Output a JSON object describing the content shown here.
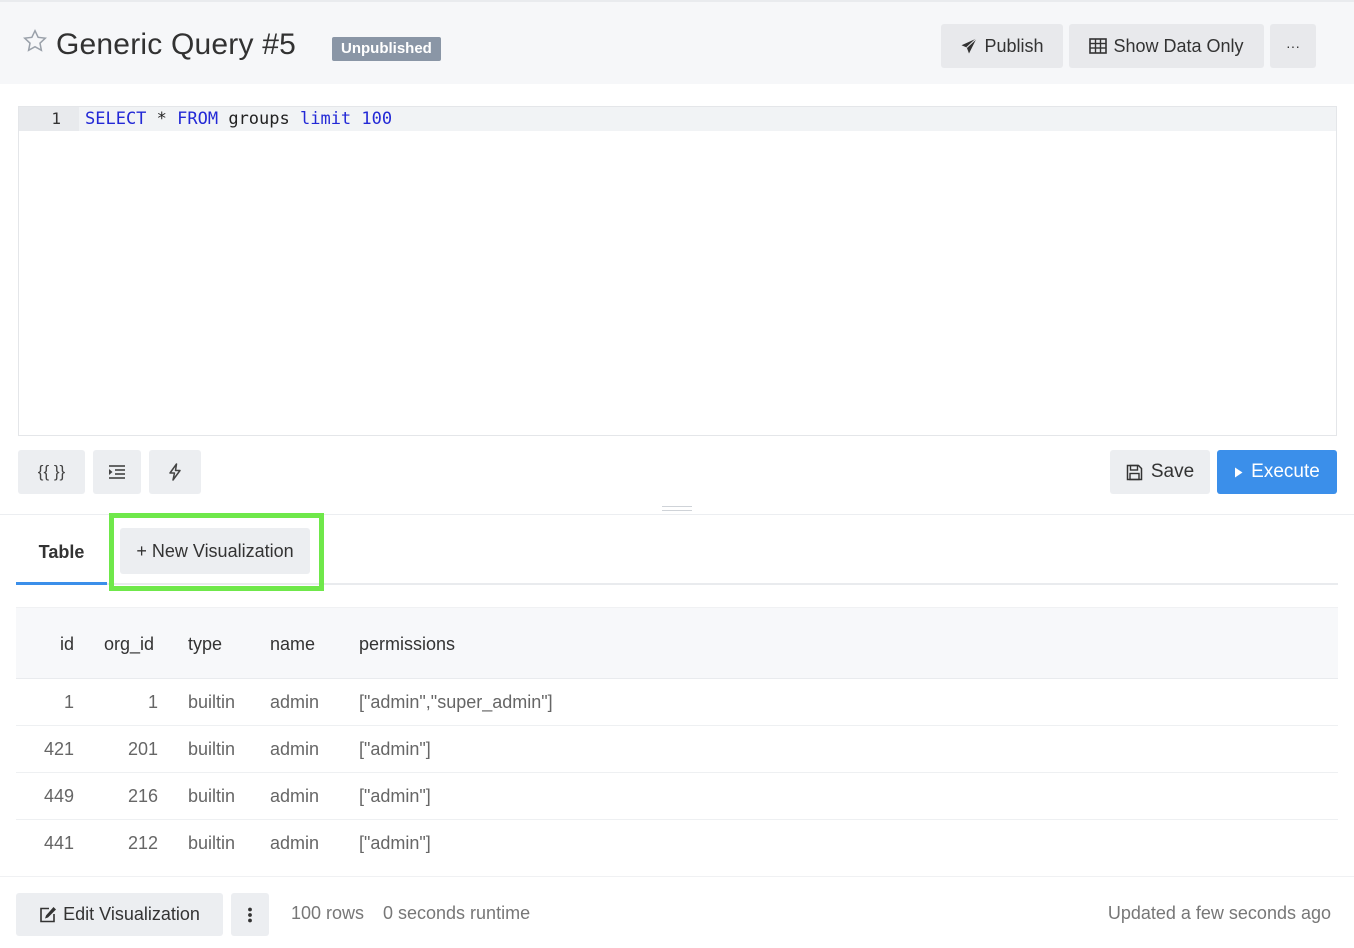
{
  "header": {
    "title": "Generic Query #5",
    "status_badge": "Unpublished",
    "publish_label": "Publish",
    "show_data_label": "Show Data Only",
    "more_label": "···"
  },
  "editor": {
    "line_number": "1",
    "code": {
      "kw1": "SELECT",
      "op": " * ",
      "kw2": "FROM",
      "table": " groups ",
      "kw3": "limit",
      "sp": " ",
      "num": "100"
    }
  },
  "toolbar": {
    "params_label": "{{ }}",
    "save_label": "Save",
    "execute_label": "Execute"
  },
  "tabs": {
    "table_label": "Table",
    "new_vis_label": "+ New Visualization"
  },
  "table": {
    "columns": [
      "id",
      "org_id",
      "type",
      "name",
      "permissions"
    ],
    "rows": [
      [
        "1",
        "1",
        "builtin",
        "admin",
        "[\"admin\",\"super_admin\"]"
      ],
      [
        "421",
        "201",
        "builtin",
        "admin",
        "[\"admin\"]"
      ],
      [
        "449",
        "216",
        "builtin",
        "admin",
        "[\"admin\"]"
      ],
      [
        "441",
        "212",
        "builtin",
        "admin",
        "[\"admin\"]"
      ]
    ]
  },
  "footer": {
    "edit_vis_label": "Edit Visualization",
    "rows_count": "100 rows",
    "runtime": "0 seconds runtime",
    "updated": "Updated a few seconds ago"
  },
  "colors": {
    "accent": "#3b8fea",
    "badge": "#8a96a6",
    "highlight": "#6fe84a"
  }
}
